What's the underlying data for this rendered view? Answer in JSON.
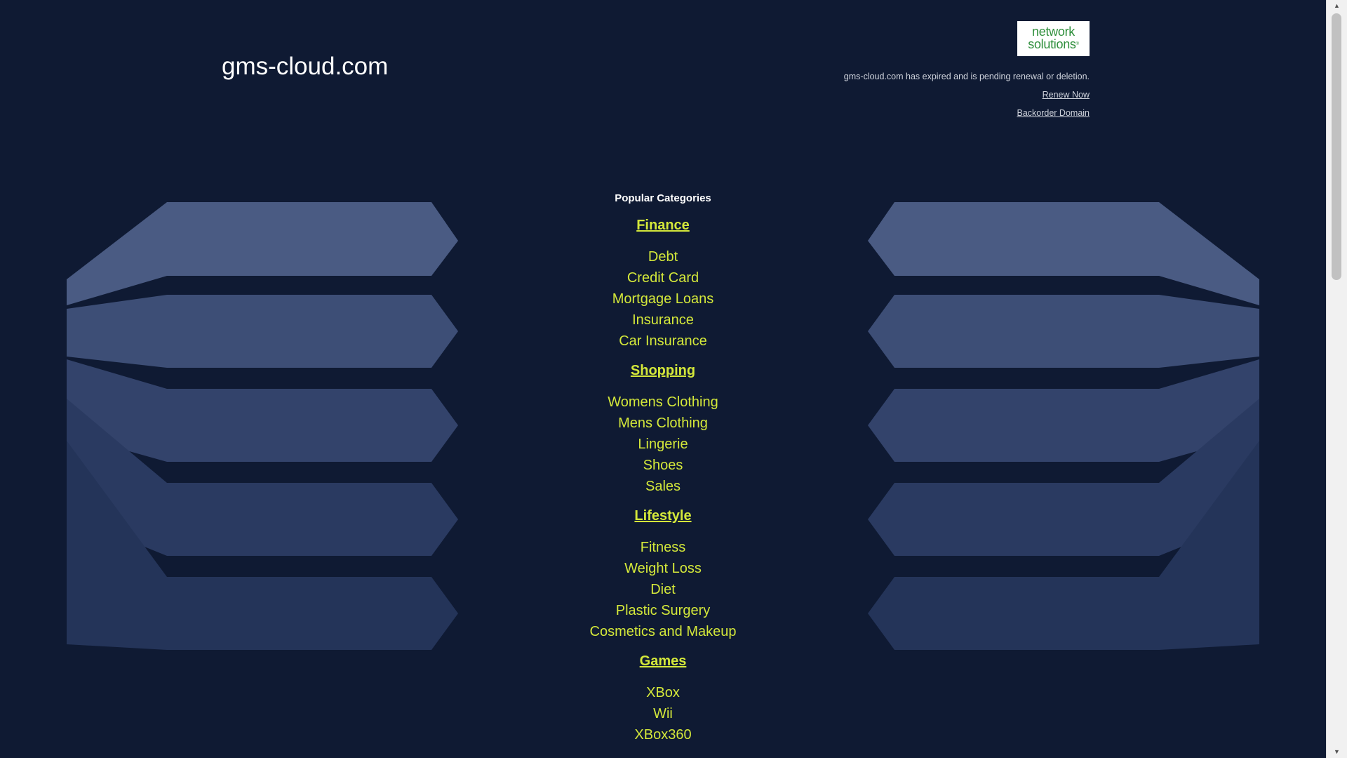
{
  "header": {
    "domain": "gms-cloud.com",
    "logo_line1": "network",
    "logo_line2": "solutions",
    "logo_mark": "®",
    "notice": "gms-cloud.com has expired and is pending renewal or deletion.",
    "renew_label": "Renew Now",
    "backorder_label": "Backorder Domain"
  },
  "categories": {
    "heading": "Popular Categories",
    "groups": [
      {
        "title": "Finance",
        "items": [
          "Debt",
          "Credit Card",
          "Mortgage Loans",
          "Insurance",
          "Car Insurance"
        ]
      },
      {
        "title": "Shopping",
        "items": [
          "Womens Clothing",
          "Mens Clothing",
          "Lingerie",
          "Shoes",
          "Sales"
        ]
      },
      {
        "title": "Lifestyle",
        "items": [
          "Fitness",
          "Weight Loss",
          "Diet",
          "Plastic Surgery",
          "Cosmetics and Makeup"
        ]
      },
      {
        "title": "Games",
        "items": [
          "XBox",
          "Wii",
          "XBox360"
        ]
      }
    ]
  },
  "colors": {
    "background": "#0f1a33",
    "link": "#d4e83a",
    "logo_green": "#2f8f3c"
  },
  "icons": {
    "scroll_up": "triangle-up-icon",
    "scroll_down": "triangle-down-icon"
  }
}
